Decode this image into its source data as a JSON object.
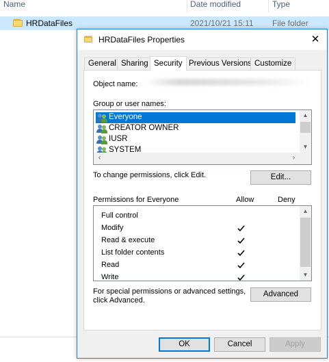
{
  "explorer": {
    "columns": {
      "name": "Name",
      "date_modified": "Date modified",
      "type": "Type"
    },
    "row": {
      "name": "HRDataFiles",
      "date": "2021/10/21 15:11",
      "type": "File folder"
    },
    "folder_icon": "folder-icon"
  },
  "dialog": {
    "title": "HRDataFiles Properties",
    "title_icon": "folder-icon",
    "close_glyph": "✕",
    "tabs": [
      "General",
      "Sharing",
      "Security",
      "Previous Versions",
      "Customize"
    ],
    "active_tab": "Security",
    "object_name_label": "Object name:",
    "group_label": "Group or user names:",
    "groups": [
      "Everyone",
      "CREATOR OWNER",
      "IUSR",
      "SYSTEM"
    ],
    "selected_group": "Everyone",
    "change_hint": "To change permissions, click Edit.",
    "edit_button": "Edit...",
    "permissions_label": "Permissions for Everyone",
    "allow_header": "Allow",
    "deny_header": "Deny",
    "permissions": [
      {
        "name": "Full control",
        "allow": false
      },
      {
        "name": "Modify",
        "allow": true
      },
      {
        "name": "Read & execute",
        "allow": true
      },
      {
        "name": "List folder contents",
        "allow": true
      },
      {
        "name": "Read",
        "allow": true
      },
      {
        "name": "Write",
        "allow": true
      }
    ],
    "advanced_hint_line1": "For special permissions or advanced settings,",
    "advanced_hint_line2": "click Advanced.",
    "advanced_button": "Advanced",
    "ok_button": "OK",
    "cancel_button": "Cancel",
    "apply_button": "Apply",
    "accent_color": "#0078d7"
  }
}
